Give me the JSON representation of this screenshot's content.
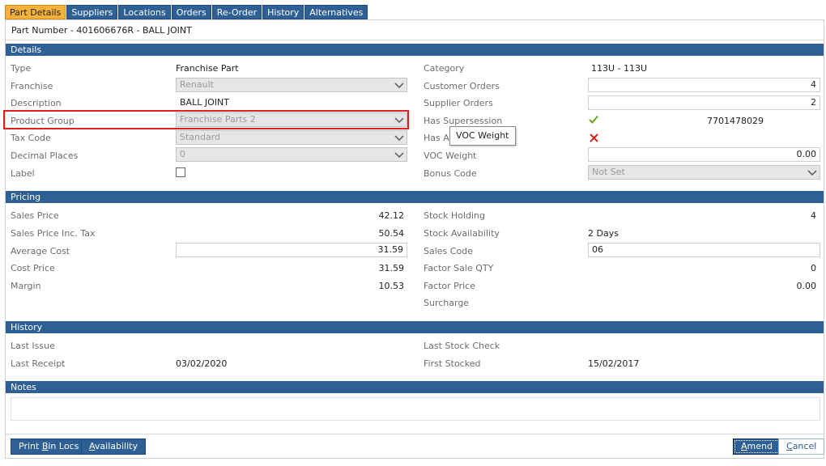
{
  "tabs": [
    {
      "label": "Part Details",
      "active": true
    },
    {
      "label": "Suppliers"
    },
    {
      "label": "Locations"
    },
    {
      "label": "Orders"
    },
    {
      "label": "Re-Order"
    },
    {
      "label": "History"
    },
    {
      "label": "Alternatives"
    }
  ],
  "part_title": "Part Number - 401606676R - BALL JOINT",
  "sections": {
    "details": "Details",
    "pricing": "Pricing",
    "history": "History",
    "notes": "Notes"
  },
  "details": {
    "type_label": "Type",
    "type_value": "Franchise Part",
    "franchise_label": "Franchise",
    "franchise_value": "Renault",
    "description_label": "Description",
    "description_value": "BALL JOINT",
    "product_group_label": "Product Group",
    "product_group_value": "Franchise Parts 2",
    "tax_code_label": "Tax Code",
    "tax_code_value": "Standard",
    "decimal_places_label": "Decimal Places",
    "decimal_places_value": "0",
    "label_label": "Label",
    "category_label": "Category",
    "category_value": "113U - 113U",
    "customer_orders_label": "Customer Orders",
    "customer_orders_value": "4",
    "supplier_orders_label": "Supplier Orders",
    "supplier_orders_value": "2",
    "has_supersession_label": "Has Supersession",
    "has_supersession_value": "7701478029",
    "has_alt_label": "Has Alt",
    "voc_weight_label": "VOC Weight",
    "voc_weight_value": "0.00",
    "bonus_code_label": "Bonus Code",
    "bonus_code_value": "Not Set",
    "tooltip": "VOC Weight"
  },
  "pricing": {
    "sales_price_label": "Sales Price",
    "sales_price_value": "42.12",
    "sales_price_inc_tax_label": "Sales Price Inc. Tax",
    "sales_price_inc_tax_value": "50.54",
    "average_cost_label": "Average Cost",
    "average_cost_value": "31.59",
    "cost_price_label": "Cost Price",
    "cost_price_value": "31.59",
    "margin_label": "Margin",
    "margin_value": "10.53",
    "stock_holding_label": "Stock Holding",
    "stock_holding_value": "4",
    "stock_availability_label": "Stock Availability",
    "stock_availability_value": "2 Days",
    "sales_code_label": "Sales Code",
    "sales_code_value": "06",
    "factor_sale_qty_label": "Factor Sale QTY",
    "factor_sale_qty_value": "0",
    "factor_price_label": "Factor Price",
    "factor_price_value": "0.00",
    "surcharge_label": "Surcharge"
  },
  "history": {
    "last_issue_label": "Last Issue",
    "last_receipt_label": "Last Receipt",
    "last_receipt_value": "03/02/2020",
    "last_stock_check_label": "Last Stock Check",
    "first_stocked_label": "First Stocked",
    "first_stocked_value": "15/02/2017"
  },
  "buttons": {
    "print_bin_locs_pre": "Print ",
    "print_bin_locs_u": "B",
    "print_bin_locs_post": "in Locs",
    "availability_pre": "",
    "availability_u": "A",
    "availability_post": "vailability",
    "amend_pre": "",
    "amend_u": "A",
    "amend_post": "mend",
    "cancel_pre": "",
    "cancel_u": "C",
    "cancel_post": "ancel"
  },
  "colors": {
    "accent": "#2e6096",
    "active_tab": "#f5b13a",
    "highlight": "#e0201c",
    "check_green": "#6aa121",
    "cross_red": "#d9201c"
  },
  "icons": {
    "supersession": "check-icon",
    "alternatives": "cross-icon",
    "dropdown": "chevron-down-icon"
  }
}
